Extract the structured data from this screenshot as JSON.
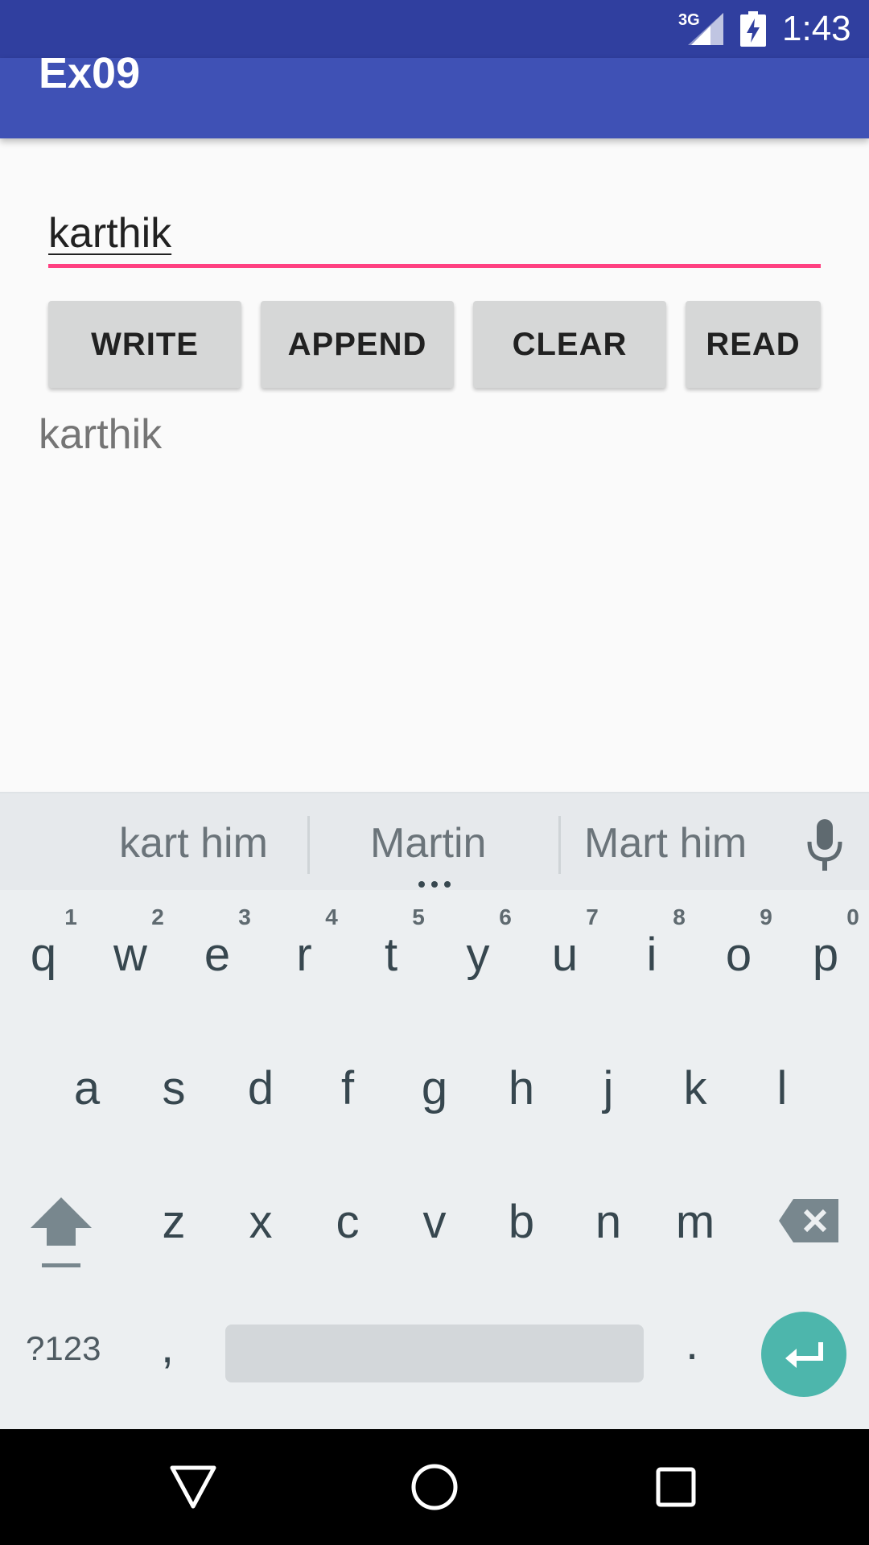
{
  "status_bar": {
    "network": "3G",
    "time": "1:43",
    "background": "#303f9f"
  },
  "app_bar": {
    "title": "Ex09",
    "background": "#3f51b5"
  },
  "input": {
    "value": "karthik",
    "accent": "#ff4081"
  },
  "buttons": {
    "write": "WRITE",
    "append": "APPEND",
    "clear": "CLEAR",
    "read": "READ"
  },
  "output": {
    "text": "karthik"
  },
  "keyboard": {
    "suggestions": [
      "kart him",
      "Martin",
      "Mart him"
    ],
    "row1": [
      {
        "letter": "q",
        "hint": "1"
      },
      {
        "letter": "w",
        "hint": "2"
      },
      {
        "letter": "e",
        "hint": "3"
      },
      {
        "letter": "r",
        "hint": "4"
      },
      {
        "letter": "t",
        "hint": "5"
      },
      {
        "letter": "y",
        "hint": "6"
      },
      {
        "letter": "u",
        "hint": "7"
      },
      {
        "letter": "i",
        "hint": "8"
      },
      {
        "letter": "o",
        "hint": "9"
      },
      {
        "letter": "p",
        "hint": "0"
      }
    ],
    "row2": [
      "a",
      "s",
      "d",
      "f",
      "g",
      "h",
      "j",
      "k",
      "l"
    ],
    "row3": [
      "z",
      "x",
      "c",
      "v",
      "b",
      "n",
      "m"
    ],
    "symbols_label": "?123",
    "comma": ",",
    "period": ".",
    "icons": [
      "mic-icon",
      "shift-icon",
      "backspace-icon",
      "enter-icon"
    ],
    "enter_color": "#4db6ac"
  },
  "navigation": {
    "icons": [
      "back-icon",
      "home-icon",
      "recent-apps-icon"
    ]
  }
}
